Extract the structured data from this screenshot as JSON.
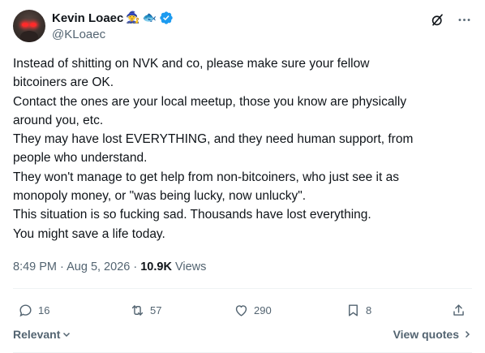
{
  "author": {
    "name": "Kevin Loaec",
    "emoji_1": "🧙",
    "emoji_2": "🐟",
    "handle": "@KLoaec",
    "verified_color": "#1d9bf0"
  },
  "header_icons": [
    "grok-icon",
    "more-icon"
  ],
  "tweet_lines": [
    "Instead of shitting on NVK and co, please make sure your fellow",
    "bitcoiners are OK.",
    "Contact the ones are your local meetup, those you know are physically",
    "around you, etc.",
    "They may have lost EVERYTHING, and they need human support, from",
    "people who understand.",
    "They won't manage to get help from non-bitcoiners, who just see it as",
    "monopoly money, or \"was being lucky, now unlucky\".",
    "This situation is so fucking sad. Thousands have lost everything.",
    "You might save a life today."
  ],
  "meta": {
    "time": "8:49 PM",
    "date": "Aug 5, 2026",
    "separator": "·",
    "views_count": "10.9K",
    "views_label": "Views"
  },
  "actions": {
    "replies": "16",
    "reposts": "57",
    "likes": "290",
    "bookmarks": "8"
  },
  "footer": {
    "sort_label": "Relevant",
    "view_quotes": "View quotes"
  }
}
